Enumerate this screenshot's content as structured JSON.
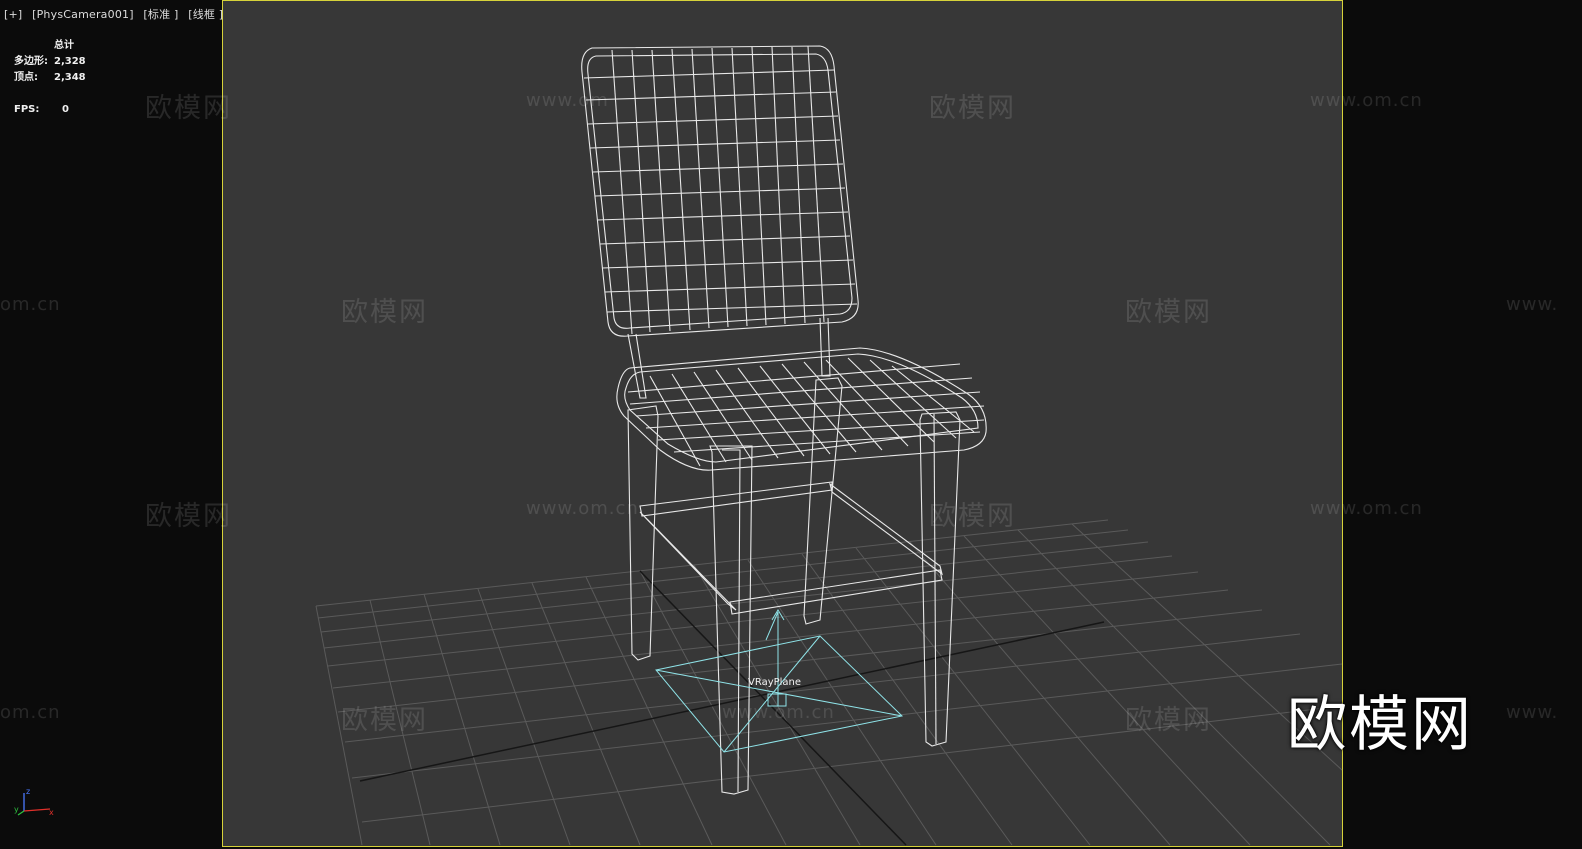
{
  "viewport": {
    "label_plus": "[+]",
    "label_camera": "[PhysCamera001]",
    "label_shading": "[标准 ]",
    "label_mode": "[线框 ]"
  },
  "stats": {
    "total_header": "总计",
    "polygons_label": "多边形:",
    "polygons_value": "2,328",
    "vertices_label": "顶点:",
    "vertices_value": "2,348",
    "fps_label": "FPS:",
    "fps_value": "0"
  },
  "scene": {
    "object_label": "VRayPlane",
    "frame_color": "#d6d23a",
    "background_color": "#373737",
    "wire_color": "#e8e8e8",
    "plane_color": "#8fe3e8",
    "grid_color": "#5a5a5a"
  },
  "watermarks": {
    "site_cn": "欧模网",
    "site_url": "www.om.cn",
    "url_fragment_left": "om.cn",
    "url_fragment_right": "www.",
    "url_fragment_mid": "www.om",
    "brand_logo": "欧模网"
  },
  "axis_tripod": {
    "x": "x",
    "y": "y",
    "z": "z"
  }
}
